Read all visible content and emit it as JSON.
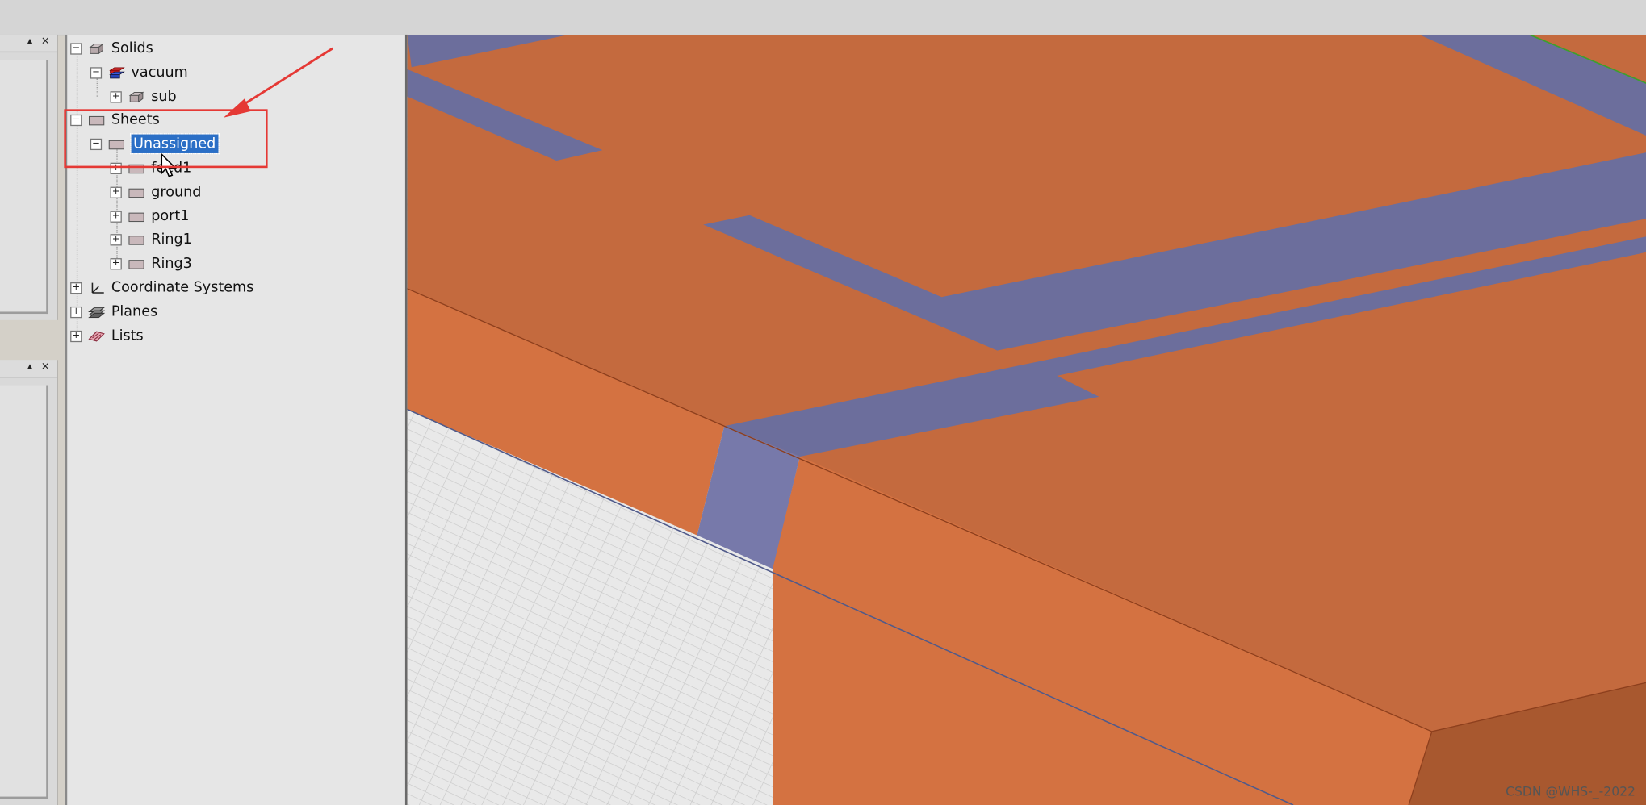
{
  "tree": {
    "items": [
      {
        "label": "Solids",
        "expander": "−",
        "icon": "solid-box-icon"
      },
      {
        "label": "vacuum",
        "expander": "−",
        "icon": "material-stack-icon"
      },
      {
        "label": "sub",
        "expander": "+",
        "icon": "solid-box-icon"
      },
      {
        "label": "Sheets",
        "expander": "−",
        "icon": "sheet-icon"
      },
      {
        "label": "Unassigned",
        "expander": "−",
        "icon": "sheet-icon"
      },
      {
        "label": "feed1",
        "expander": "+",
        "icon": "sheet-icon"
      },
      {
        "label": "ground",
        "expander": "+",
        "icon": "sheet-icon"
      },
      {
        "label": "port1",
        "expander": "+",
        "icon": "sheet-icon"
      },
      {
        "label": "Ring1",
        "expander": "+",
        "icon": "sheet-icon"
      },
      {
        "label": "Ring3",
        "expander": "+",
        "icon": "sheet-icon"
      },
      {
        "label": "Coordinate Systems",
        "expander": "+",
        "icon": "coordinate-axes-icon"
      },
      {
        "label": "Planes",
        "expander": "+",
        "icon": "planes-icon"
      },
      {
        "label": "Lists",
        "expander": "+",
        "icon": "lists-icon"
      }
    ]
  },
  "panels": {
    "pin_glyph": "▴",
    "close_glyph": "×"
  },
  "watermark": "CSDN @WHS-_-2022",
  "colors": {
    "copper": "#c46a3e",
    "copper_side": "#d47241",
    "trace": "#6c6e9c",
    "selection": "#2b6fc6",
    "annotation": "#e53935"
  }
}
